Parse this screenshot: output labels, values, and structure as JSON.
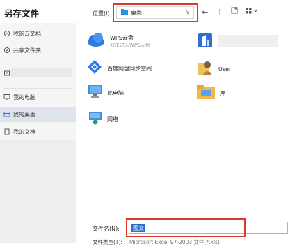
{
  "dialog": {
    "title": "另存文件"
  },
  "sidebar": {
    "items": [
      {
        "label": "我的云文档"
      },
      {
        "label": "共享文件夹"
      },
      {
        "label": ""
      },
      {
        "label": "我的电脑"
      },
      {
        "label": "我的桌面"
      },
      {
        "label": "我的文档"
      }
    ]
  },
  "toolbar": {
    "location_label": "位置(I):",
    "location_value": "桌面"
  },
  "content": {
    "items": [
      {
        "label": "WPS云盘",
        "sublabel": "双击进入WPS云盘"
      },
      {
        "label": ""
      },
      {
        "label": "百度网盘同步空间"
      },
      {
        "label": "User"
      },
      {
        "label": "此电脑"
      },
      {
        "label": "库"
      },
      {
        "label": "网络"
      }
    ]
  },
  "footer": {
    "filename_label": "文件名(N):",
    "filename_value": "图文",
    "filetype_label": "文件类型(T):",
    "filetype_value": "Microsoft Excel 97-2003 文件(*.xls)"
  },
  "colors": {
    "highlight": "#d63a2a",
    "selection": "#2b6fd6",
    "active_sidebar": "#dfe4ec"
  }
}
